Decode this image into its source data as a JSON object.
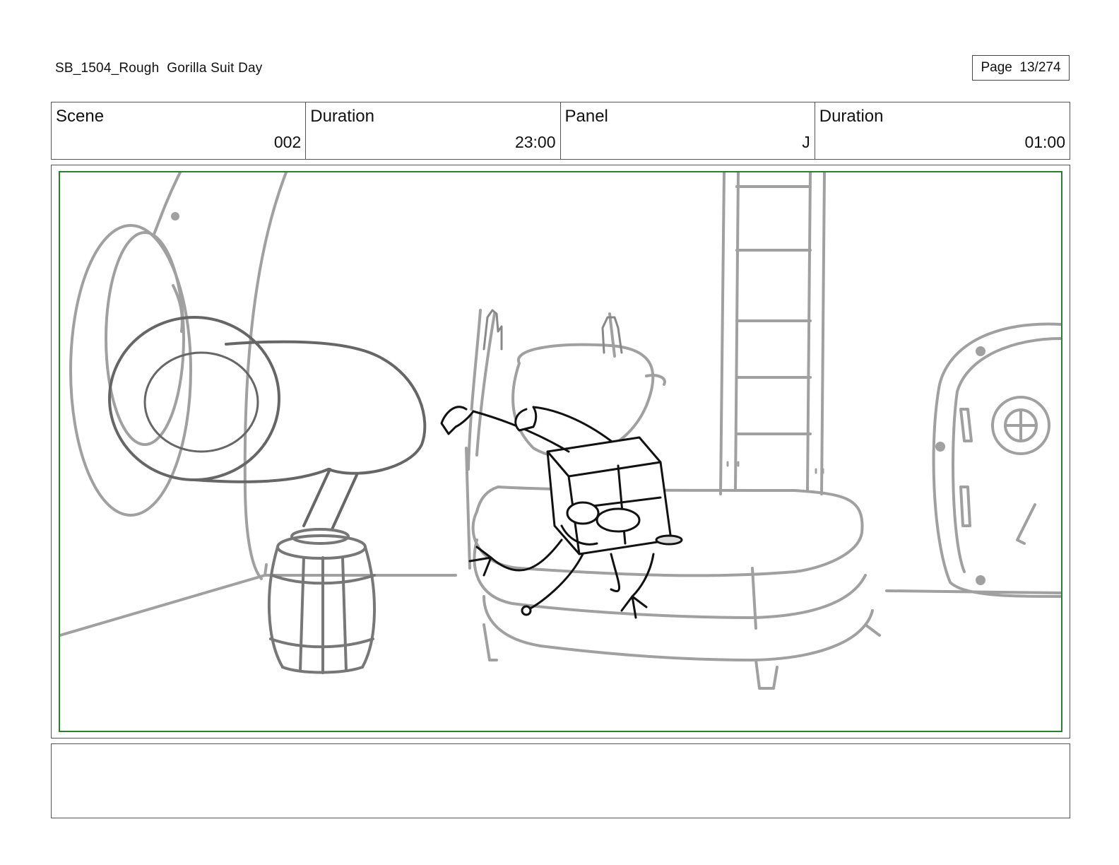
{
  "header": {
    "title": "SB_1504_Rough  Gorilla Suit Day",
    "page": "Page  13/274"
  },
  "info": {
    "scene_label": "Scene",
    "scene_value": "002",
    "scene_duration_label": "Duration",
    "scene_duration_value": "23:00",
    "panel_label": "Panel",
    "panel_value": "J",
    "panel_duration_label": "Duration",
    "panel_duration_value": "01:00"
  },
  "notes": {
    "text": ""
  },
  "colors": {
    "safe_frame": "#2e7d32",
    "sketch_grey": "#9a9a9a",
    "ink": "#111111"
  }
}
